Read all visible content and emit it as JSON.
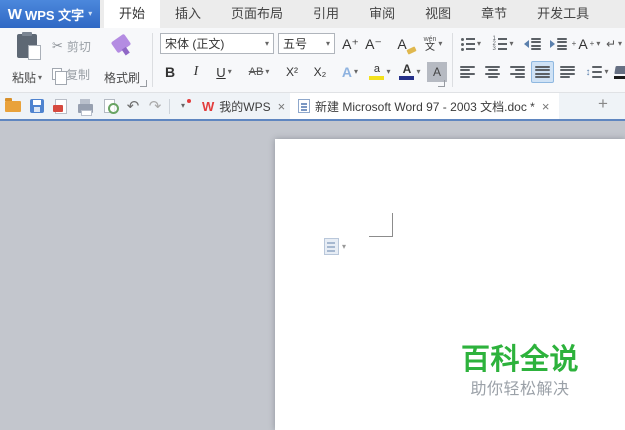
{
  "colors": {
    "titlebar_blue": "#3e7bd4",
    "tab_underline_blue": "#5f86c0",
    "doc_background_gray": "#c3c6cd",
    "watermark_green": "#2db23c",
    "format_painter_purple": "#b48ce2",
    "highlight_yellow": "#f3e11c",
    "font_color_navy": "#253089"
  },
  "icons": {
    "caret": "▾",
    "close": "×",
    "plus": "+",
    "undo": "↶",
    "redo": "↷",
    "scissors": "✂",
    "return": "↵",
    "updown": "↕",
    "logo": "W",
    "red_logo": "W",
    "num1": "1",
    "num2": "2",
    "num3": "3"
  },
  "titlebar": {
    "app_name": "WPS 文字",
    "menu_tabs": [
      "开始",
      "插入",
      "页面布局",
      "引用",
      "审阅",
      "视图",
      "章节",
      "开发工具"
    ],
    "active_tab": "开始"
  },
  "ribbon": {
    "paste_label": "粘贴",
    "cut_label": "剪切",
    "copy_label": "复制",
    "format_painter_label": "格式刷",
    "font_name_value": "宋体 (正文)",
    "font_size_value": "五号",
    "grow_font": "A⁺",
    "shrink_font": "A⁻",
    "clear_format": "A",
    "pinyin_top": "wén",
    "pinyin_bottom": "文",
    "bold": "B",
    "italic": "I",
    "underline": "U",
    "strikethrough": "AB",
    "superscript": "X²",
    "subscript": "X₂",
    "text_effect": "A",
    "highlight": "a",
    "font_color": "A",
    "char_shading": "A",
    "autofit": "A"
  },
  "quickbar": {
    "doc_tabs": [
      {
        "label": "我的WPS",
        "active": false
      },
      {
        "label": "新建 Microsoft Word 97 - 2003 文档.doc *",
        "active": true
      }
    ]
  },
  "document": {
    "watermark_title": "百科全说",
    "watermark_subtitle": "助你轻松解决"
  }
}
